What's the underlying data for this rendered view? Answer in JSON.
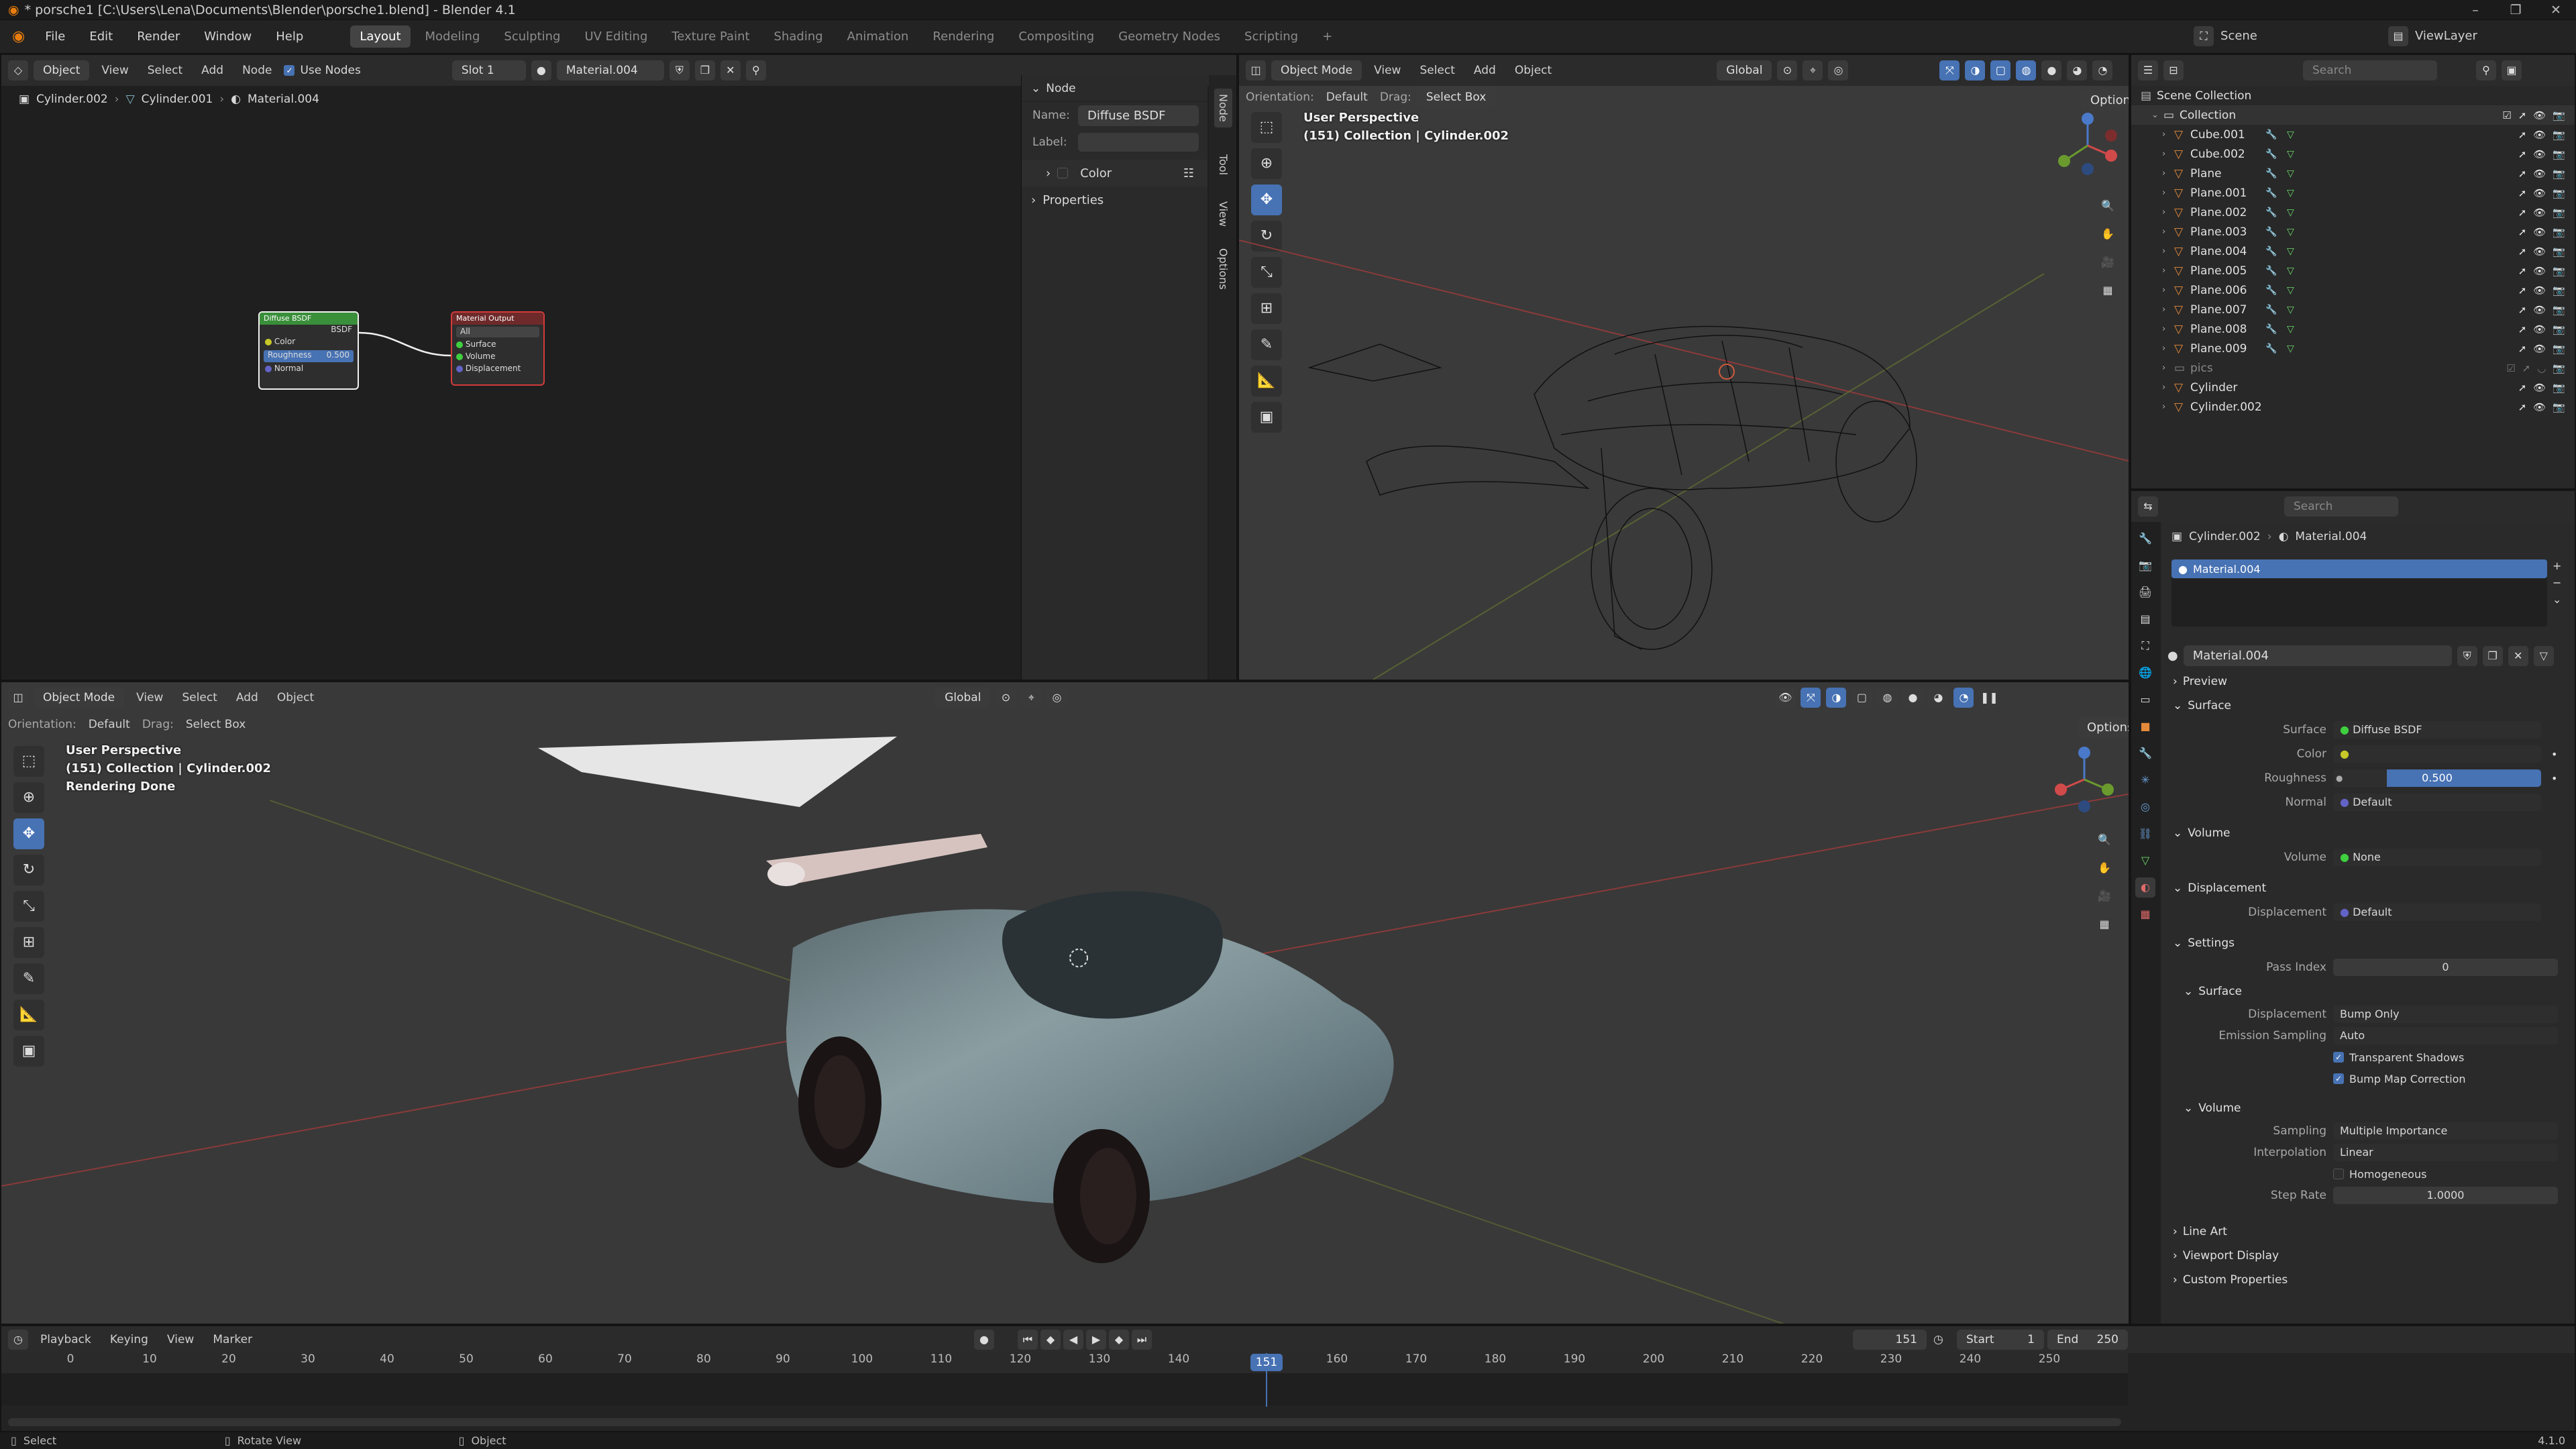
{
  "window": {
    "title": "* porsche1 [C:\\Users\\Lena\\Documents\\Blender\\porsche1.blend] - Blender 4.1"
  },
  "menu": [
    "File",
    "Edit",
    "Render",
    "Window",
    "Help"
  ],
  "workspaces": [
    "Layout",
    "Modeling",
    "Sculpting",
    "UV Editing",
    "Texture Paint",
    "Shading",
    "Animation",
    "Rendering",
    "Compositing",
    "Geometry Nodes",
    "Scripting"
  ],
  "topbar_right": {
    "scene": "Scene",
    "view_layer": "ViewLayer"
  },
  "node_editor": {
    "mode": "Object",
    "menus": [
      "View",
      "Select",
      "Add",
      "Node"
    ],
    "use_nodes": "Use Nodes",
    "slot": "Slot 1",
    "material": "Material.004",
    "breadcrumb": [
      "Cylinder.002",
      "Cylinder.001",
      "Material.004"
    ],
    "node_diffuse": {
      "title": "Diffuse BSDF",
      "out": "BSDF",
      "color": "Color",
      "roughness": "Roughness",
      "roughness_val": "0.500",
      "normal": "Normal"
    },
    "node_output": {
      "title": "Material Output",
      "target": "All",
      "surface": "Surface",
      "volume": "Volume",
      "displacement": "Displacement"
    },
    "panel": {
      "header": "Node",
      "name_label": "Name:",
      "name_value": "Diffuse BSDF",
      "label_label": "Label:",
      "color": "Color",
      "properties": "Properties"
    },
    "tabs": [
      "Node",
      "Tool",
      "View",
      "Options"
    ]
  },
  "viewport_top": {
    "mode": "Object Mode",
    "menus": [
      "View",
      "Select",
      "Add",
      "Object"
    ],
    "orientation_label": "Orientation:",
    "orientation": "Default",
    "drag_label": "Drag:",
    "drag": "Select Box",
    "transform": "Global",
    "options": "Options",
    "overlay_line1": "User Perspective",
    "overlay_line2": "(151) Collection | Cylinder.002"
  },
  "viewport_bottom": {
    "mode": "Object Mode",
    "menus": [
      "View",
      "Select",
      "Add",
      "Object"
    ],
    "orientation_label": "Orientation:",
    "orientation": "Default",
    "drag_label": "Drag:",
    "drag": "Select Box",
    "transform": "Global",
    "options": "Options",
    "overlay_line1": "User Perspective",
    "overlay_line2": "(151) Collection | Cylinder.002",
    "overlay_line3": "Rendering Done"
  },
  "outliner": {
    "search_placeholder": "Search",
    "root": "Scene Collection",
    "collection": "Collection",
    "items": [
      "Cube.001",
      "Cube.002",
      "Plane",
      "Plane.001",
      "Plane.002",
      "Plane.003",
      "Plane.004",
      "Plane.005",
      "Plane.006",
      "Plane.007",
      "Plane.008",
      "Plane.009"
    ],
    "pics": "pics",
    "cylinder": "Cylinder",
    "cylinder2": "Cylinder.002"
  },
  "properties": {
    "search_placeholder": "Search",
    "breadcrumb_object": "Cylinder.002",
    "breadcrumb_material": "Material.004",
    "slot_item": "Material.004",
    "material_name": "Material.004",
    "sections": {
      "preview": "Preview",
      "surface": "Surface",
      "volume": "Volume",
      "displacement": "Displacement",
      "settings": "Settings",
      "settings_surface": "Surface",
      "settings_volume": "Volume",
      "line_art": "Line Art",
      "viewport_display": "Viewport Display",
      "custom_properties": "Custom Properties"
    },
    "surface_label": "Surface",
    "surface_value": "Diffuse BSDF",
    "color_label": "Color",
    "roughness_label": "Roughness",
    "roughness_value": "0.500",
    "normal_label": "Normal",
    "normal_value": "Default",
    "volume_label": "Volume",
    "volume_value": "None",
    "displacement_label": "Displacement",
    "displacement_value": "Default",
    "pass_index_label": "Pass Index",
    "pass_index_value": "0",
    "disp_method_label": "Displacement",
    "disp_method_value": "Bump Only",
    "emission_label": "Emission Sampling",
    "emission_value": "Auto",
    "transparent_shadows": "Transparent Shadows",
    "bump_map_correction": "Bump Map Correction",
    "sampling_label": "Sampling",
    "sampling_value": "Multiple Importance",
    "interpolation_label": "Interpolation",
    "interpolation_value": "Linear",
    "homogeneous": "Homogeneous",
    "step_rate_label": "Step Rate",
    "step_rate_value": "1.0000"
  },
  "timeline": {
    "menus": [
      "Playback",
      "Keying",
      "View",
      "Marker"
    ],
    "current_frame": "151",
    "start_label": "Start",
    "start_value": "1",
    "end_label": "End",
    "end_value": "250",
    "ticks": [
      "0",
      "10",
      "20",
      "30",
      "40",
      "50",
      "60",
      "70",
      "80",
      "90",
      "100",
      "110",
      "120",
      "130",
      "140",
      "151",
      "160",
      "170",
      "180",
      "190",
      "200",
      "210",
      "220",
      "230",
      "240",
      "250"
    ]
  },
  "statusbar": {
    "select": "Select",
    "rotate": "Rotate View",
    "object": "Object",
    "version": "4.1.0"
  }
}
